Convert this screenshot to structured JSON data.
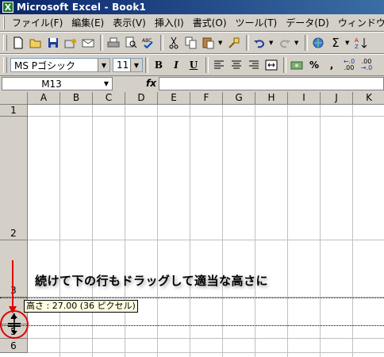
{
  "window": {
    "title": "Microsoft Excel - Book1",
    "app_icon_glyph": "X"
  },
  "menu": [
    "ファイル(F)",
    "編集(E)",
    "表示(V)",
    "挿入(I)",
    "書式(O)",
    "ツール(T)",
    "データ(D)",
    "ウィンドウ(W)"
  ],
  "toolbar": {
    "standard_icons": [
      "new-icon",
      "open-icon",
      "save-icon",
      "permission-icon",
      "email-icon",
      "print-icon",
      "print-preview-icon",
      "spelling-icon",
      "cut-icon",
      "copy-icon",
      "paste-icon",
      "format-painter-icon",
      "undo-icon",
      "redo-icon",
      "hyperlink-icon",
      "autosum-icon",
      "sort-ascending-icon"
    ],
    "font_name": "MS Pゴシック",
    "font_size": "11",
    "format_icons": [
      "bold-icon",
      "italic-icon",
      "underline-icon",
      "align-left-icon",
      "align-center-icon",
      "align-right-icon",
      "merge-center-icon",
      "currency-icon",
      "percent-icon",
      "comma-icon",
      "increase-decimal-icon",
      "decrease-decimal-icon"
    ]
  },
  "formula_bar": {
    "name_box": "M13",
    "fx_label": "fx",
    "formula": ""
  },
  "grid": {
    "columns": [
      "A",
      "B",
      "C",
      "D",
      "E",
      "F",
      "G",
      "H",
      "I",
      "J",
      "K"
    ],
    "rows": [
      "1",
      "2",
      "3",
      "4",
      "5",
      "6"
    ]
  },
  "annotation": {
    "text": "続けて下の行もドラッグして適当な高さに",
    "tooltip": "高さ : 27.00 (36 ピクセル)",
    "colors": {
      "arrow": "#e00000",
      "circle": "#e00000"
    }
  }
}
